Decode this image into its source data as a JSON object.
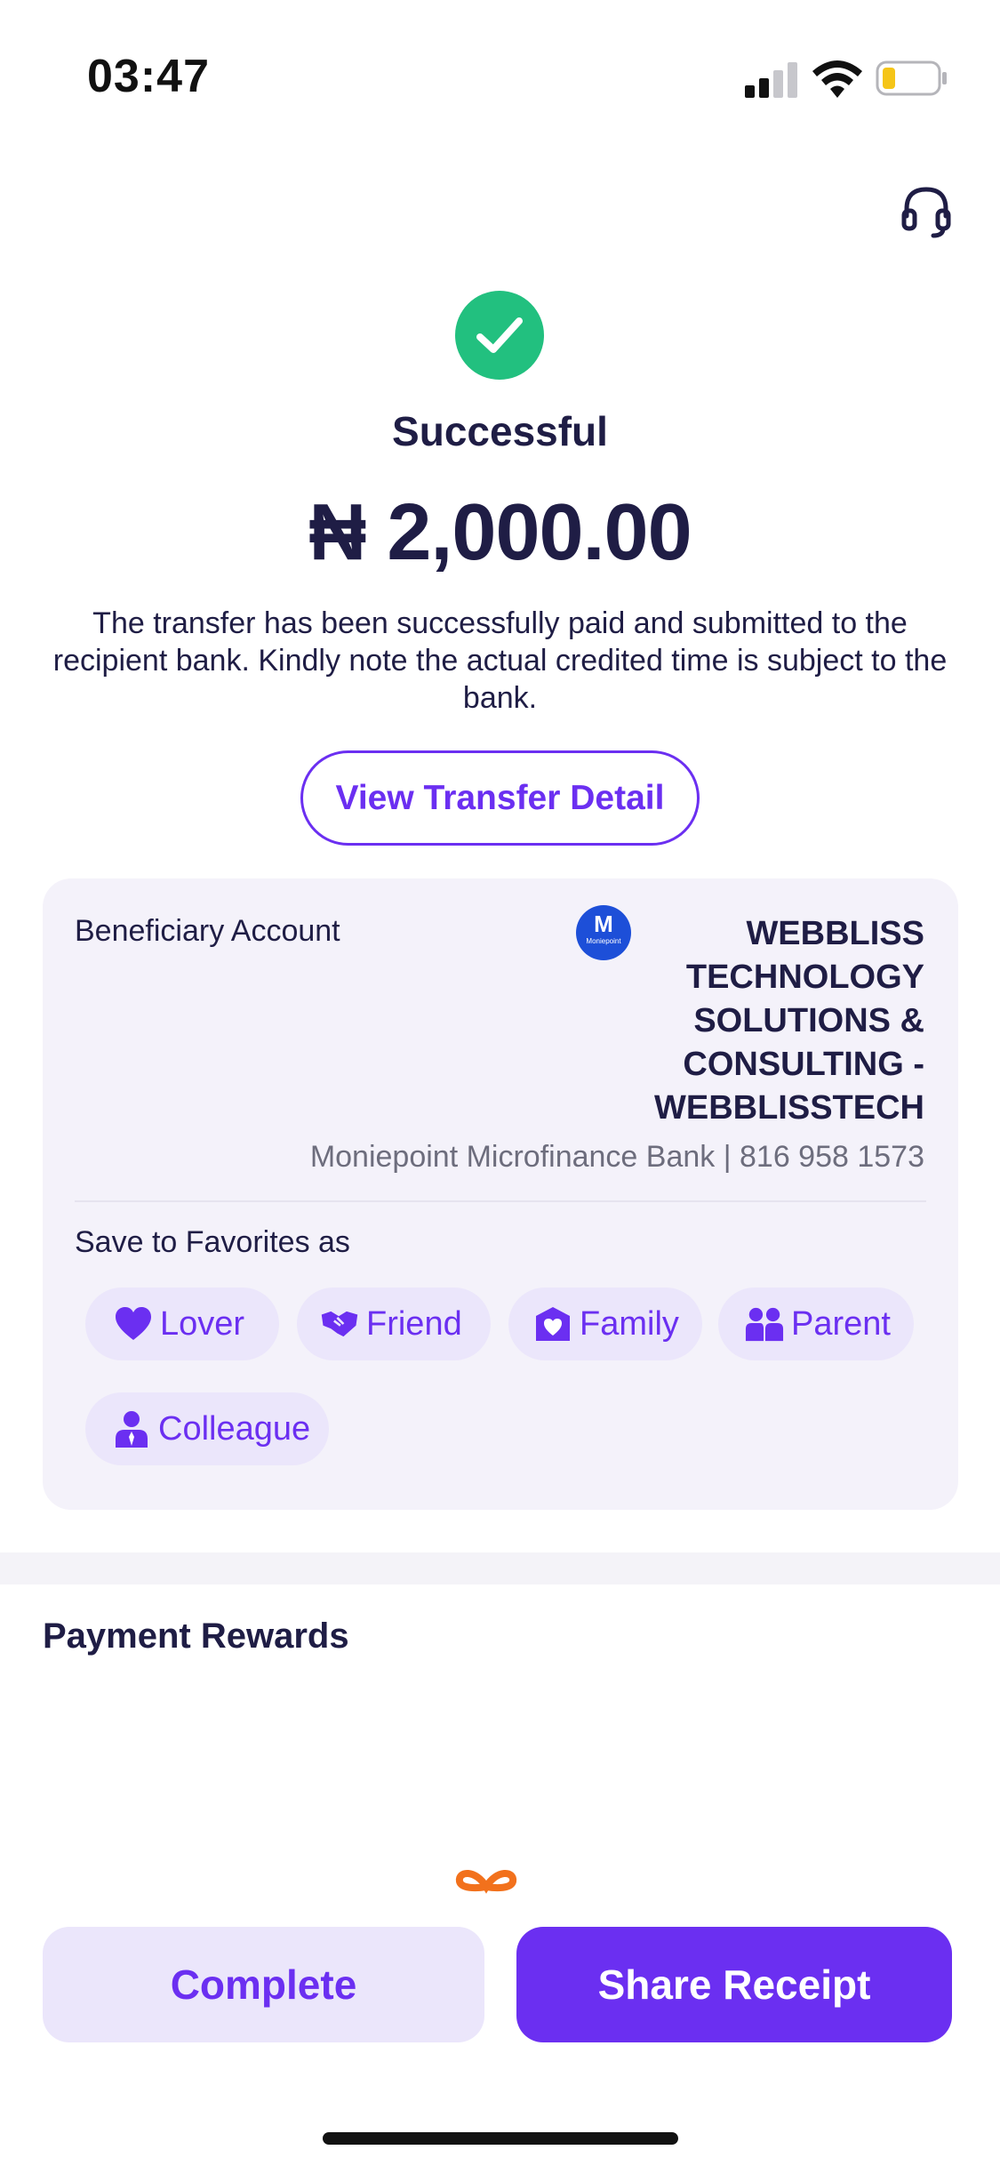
{
  "status_bar": {
    "time": "03:47",
    "icons": [
      "signal-icon",
      "wifi-icon",
      "battery-low-icon"
    ],
    "battery_color": "#f5c518"
  },
  "header": {
    "support_icon": "headset-icon"
  },
  "result": {
    "status_icon": "check-circle-icon",
    "status_color": "#22c07f",
    "status": "Successful",
    "amount": "₦ 2,000.00",
    "message": "The transfer has been successfully paid and submitted to the recipient bank. Kindly note the actual credited time is subject to the bank."
  },
  "view_detail_label": "View Transfer Detail",
  "beneficiary": {
    "label": "Beneficiary Account",
    "bank_logo_letter": "M",
    "bank_logo_text": "Moniepoint",
    "name": "WEBBLISS TECHNOLOGY SOLUTIONS & CONSULTING - WEBBLISSTECH",
    "bank_line": "Moniepoint Microfinance Bank | 816 958 1573"
  },
  "favorites": {
    "label": "Save to Favorites as",
    "options": [
      {
        "label": "Lover",
        "icon": "heart-icon"
      },
      {
        "label": "Friend",
        "icon": "handshake-icon"
      },
      {
        "label": "Family",
        "icon": "family-home-icon"
      },
      {
        "label": "Parent",
        "icon": "parents-icon"
      },
      {
        "label": "Colleague",
        "icon": "colleague-icon"
      }
    ]
  },
  "rewards": {
    "title": "Payment Rewards",
    "icon": "gift-icon"
  },
  "actions": {
    "complete": "Complete",
    "share": "Share Receipt"
  },
  "colors": {
    "accent": "#6b2ff1",
    "accent_light": "#ebe6fb",
    "text": "#1f1d45",
    "success": "#22c07f"
  }
}
